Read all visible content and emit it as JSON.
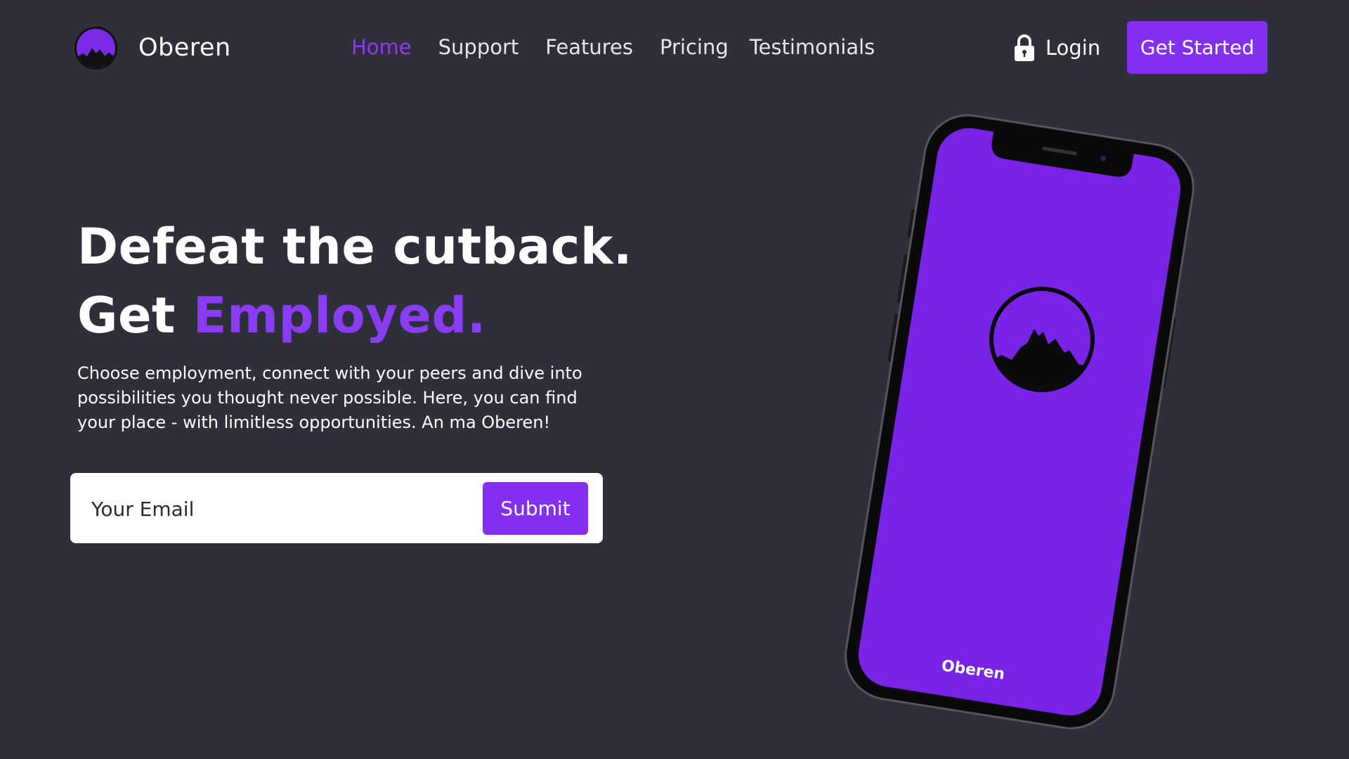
{
  "brand": {
    "name": "Oberen",
    "logo_icon": "mountain-circle-logo"
  },
  "nav": {
    "links": [
      {
        "label": "Home",
        "active": true
      },
      {
        "label": "Support",
        "active": false
      },
      {
        "label": "Features",
        "active": false
      },
      {
        "label": "Pricing",
        "active": false
      },
      {
        "label": "Testimonials",
        "active": false
      }
    ],
    "login_label": "Login",
    "login_icon": "lock-icon",
    "cta_label": "Get Started"
  },
  "hero": {
    "line1": "Defeat the cutback.",
    "line2_prefix": "Get ",
    "line2_accent": "Employed.",
    "description": "Choose employment, connect with your peers and dive into possibilities you thought never possible. Here, you can find your place - with limitless opportunities. An ma Oberen!"
  },
  "form": {
    "email_placeholder": "Your Email",
    "email_value": "",
    "submit_label": "Submit"
  },
  "phone": {
    "screen_brand": "Oberen",
    "logo_icon": "mountain-circle-logo"
  },
  "colors": {
    "background": "#2f2f3a",
    "accent": "#8330f2",
    "accent_text": "#8a3cf5",
    "phone_screen": "#7a23e8"
  }
}
